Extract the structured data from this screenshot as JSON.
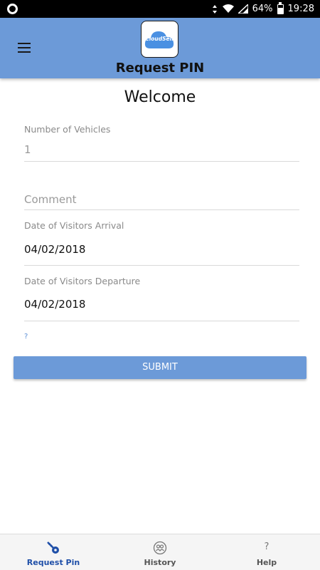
{
  "status_bar": {
    "battery": "64%",
    "time": "19:28"
  },
  "header": {
    "logo_text": "CloudSell",
    "title": "Request PIN"
  },
  "form": {
    "welcome": "Welcome",
    "vehicles": {
      "label": "Number of Vehicles",
      "value": "1"
    },
    "comment": {
      "placeholder": "Comment"
    },
    "arrival": {
      "label": "Date of Visitors Arrival",
      "value": "04/02/2018"
    },
    "departure": {
      "label": "Date of Visitors Departure",
      "value": "04/02/2018"
    },
    "hint": "?",
    "submit_label": "SUBMIT"
  },
  "bottom_nav": {
    "items": [
      {
        "label": "Request Pin",
        "icon": "key-icon",
        "active": true
      },
      {
        "label": "History",
        "icon": "history-icon",
        "active": false
      },
      {
        "label": "Help",
        "icon": "help-icon",
        "glyph": "?",
        "active": false
      }
    ]
  },
  "colors": {
    "accent": "#6c9ad8",
    "active_nav": "#1f4fa8",
    "link": "#5b8fd6"
  }
}
